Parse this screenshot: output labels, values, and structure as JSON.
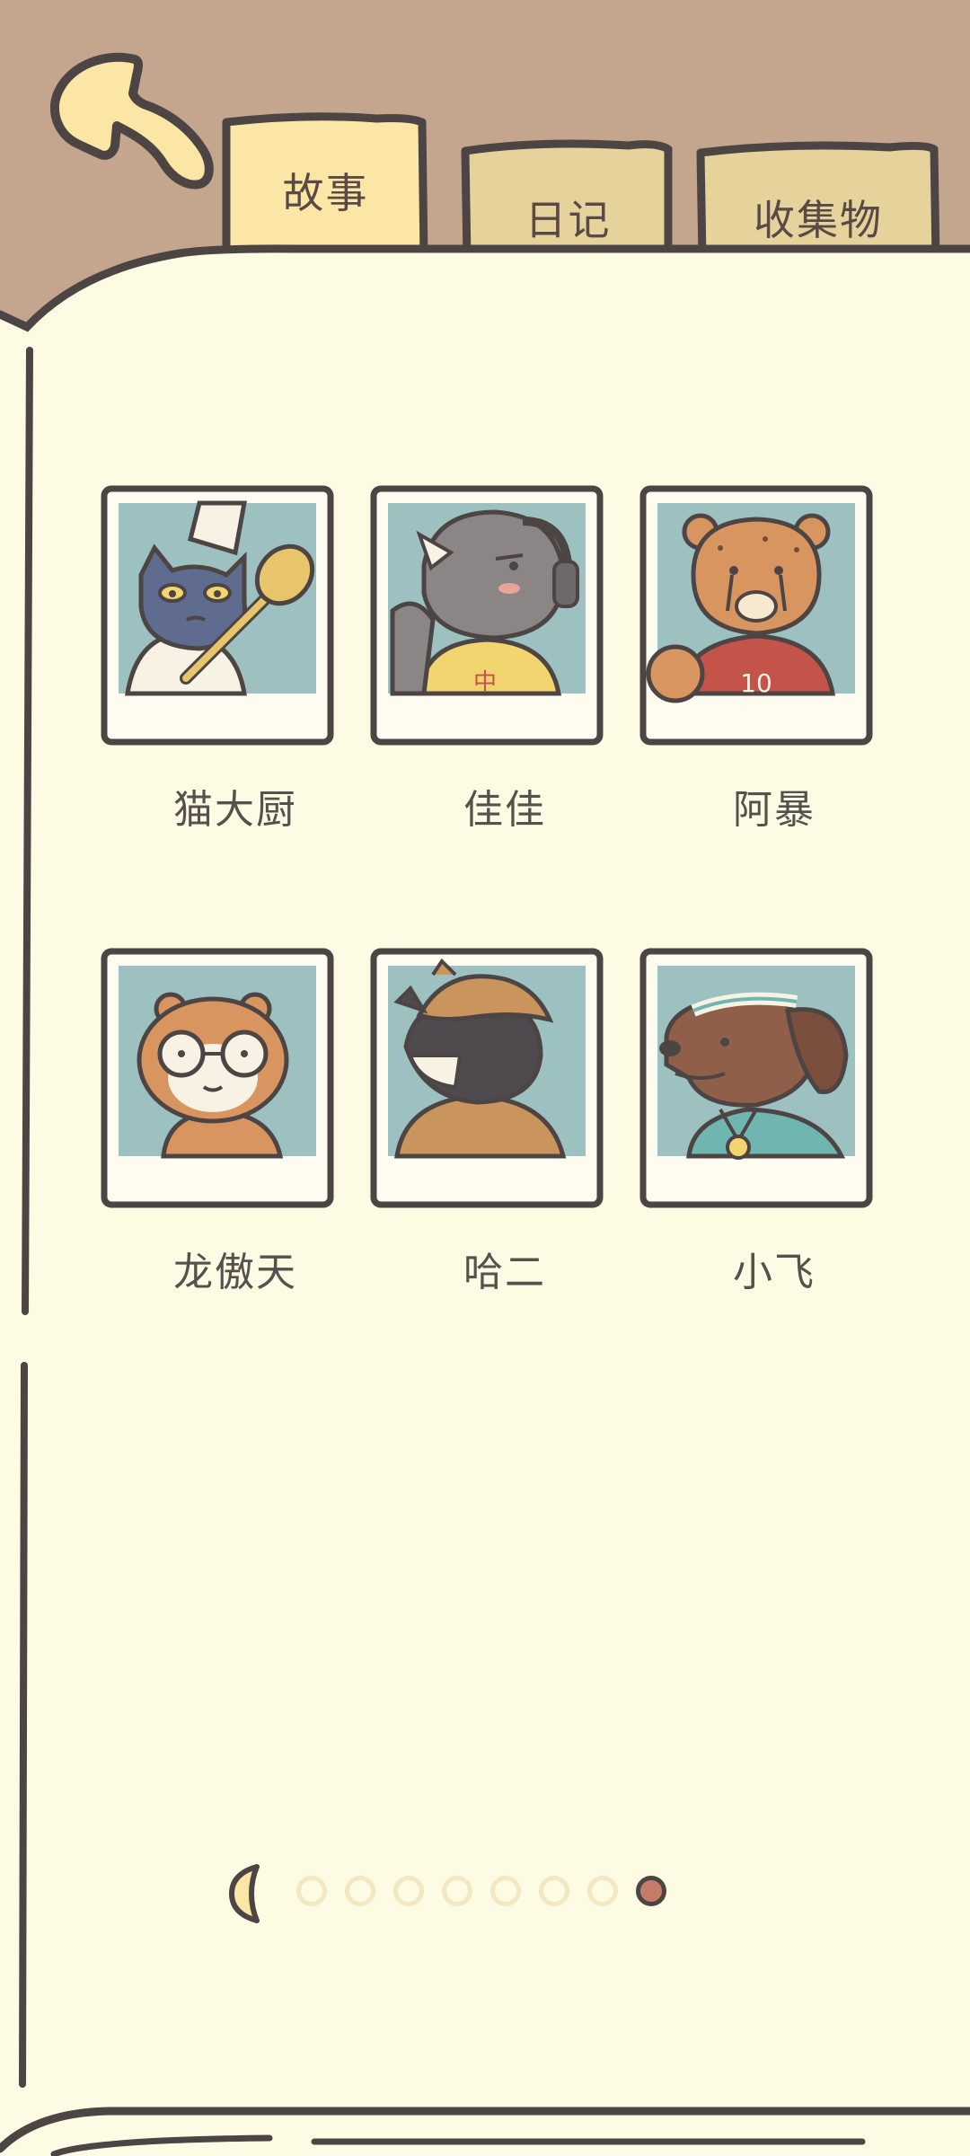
{
  "tabs": {
    "story": "故事",
    "diary": "日记",
    "collection": "收集物"
  },
  "characters": [
    {
      "name": "猫大厨",
      "icon": "chef-cat-portrait"
    },
    {
      "name": "佳佳",
      "icon": "rhino-dj-portrait"
    },
    {
      "name": "阿暴",
      "icon": "cheetah-basketball-portrait"
    },
    {
      "name": "龙傲天",
      "icon": "hamster-glasses-portrait"
    },
    {
      "name": "哈二",
      "icon": "husky-detective-portrait"
    },
    {
      "name": "小飞",
      "icon": "dachshund-athlete-portrait"
    }
  ],
  "pagination": {
    "total_pages": 8,
    "current_page": 8
  },
  "colors": {
    "background_brown": "#c4a58d",
    "paper": "#fdfbe3",
    "tab_active": "#fbe6a5",
    "tab_inactive": "#e5d39b",
    "outline": "#4d4444",
    "photo_bg": "#9dc1c1",
    "dot_active": "#c47c68",
    "dot_inactive": "#f3e7c4"
  }
}
